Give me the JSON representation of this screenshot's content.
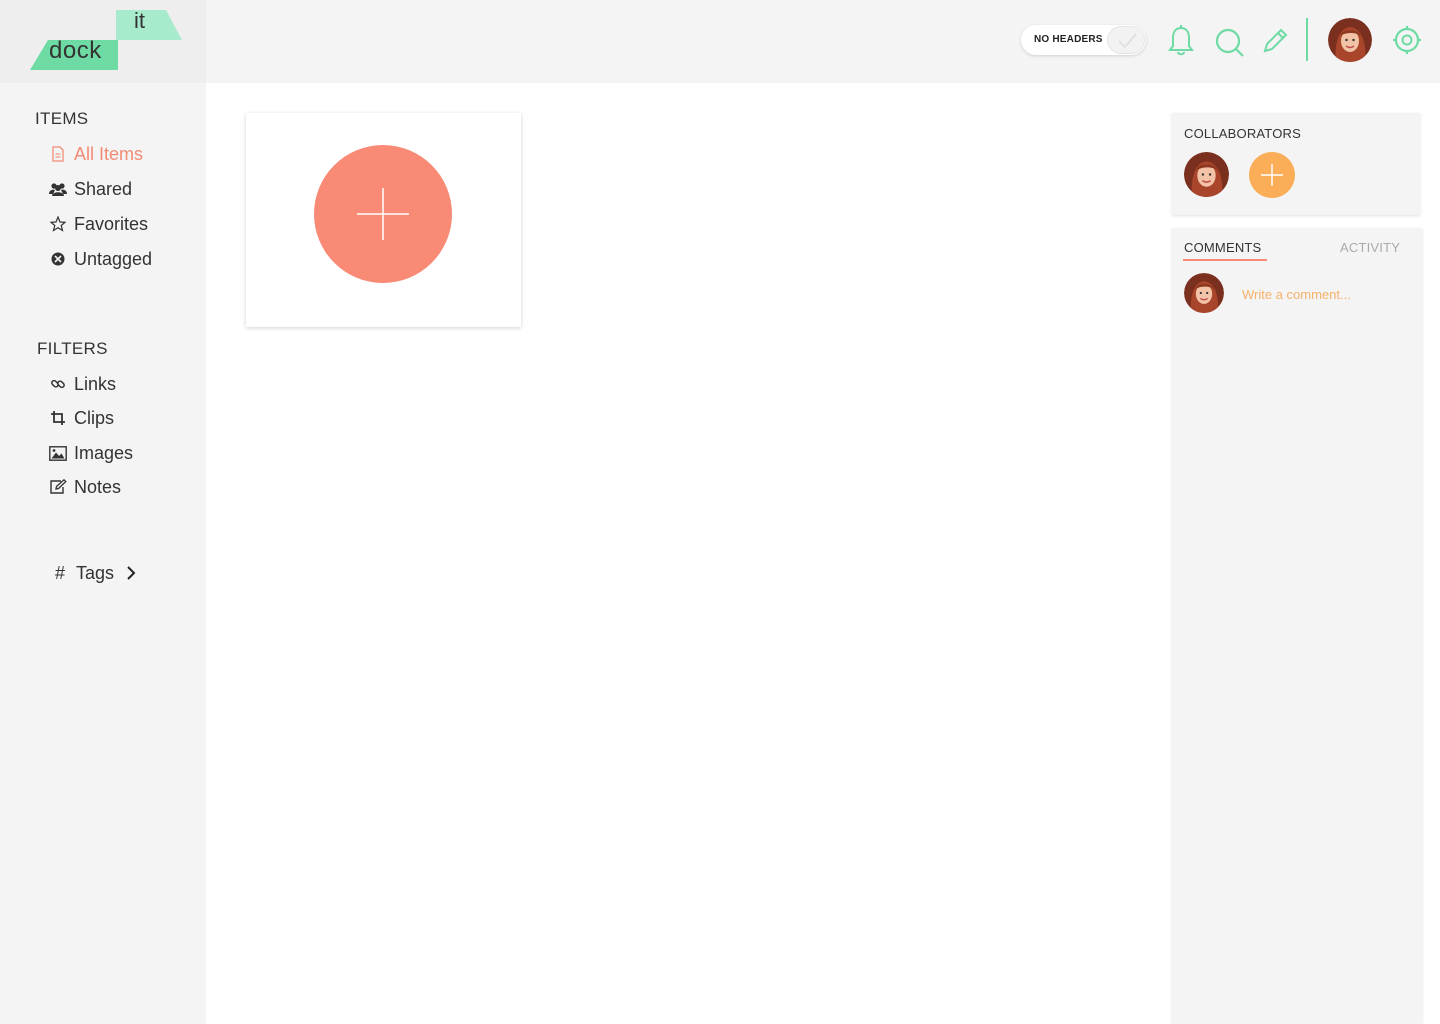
{
  "brand": {
    "logo_top": "it",
    "logo_bottom": "dock"
  },
  "header": {
    "toggle_label": "NO HEADERS",
    "accent_color": "#6ddba3",
    "icons": [
      "bell-icon",
      "search-icon",
      "pencil-icon",
      "gear-icon"
    ]
  },
  "sidebar": {
    "items_title": "ITEMS",
    "items": [
      {
        "label": "All Items",
        "icon": "document-icon",
        "active": true
      },
      {
        "label": "Shared",
        "icon": "users-icon"
      },
      {
        "label": "Favorites",
        "icon": "star-icon"
      },
      {
        "label": "Untagged",
        "icon": "untagged-icon"
      }
    ],
    "filters_title": "FILTERS",
    "filters": [
      {
        "label": "Links",
        "icon": "link-icon"
      },
      {
        "label": "Clips",
        "icon": "crop-icon"
      },
      {
        "label": "Images",
        "icon": "image-icon"
      },
      {
        "label": "Notes",
        "icon": "edit-icon"
      }
    ],
    "tags": {
      "symbol": "#",
      "label": "Tags"
    }
  },
  "right_panel": {
    "collaborators_title": "COLLABORATORS",
    "tabs": [
      {
        "label": "COMMENTS",
        "active": true
      },
      {
        "label": "ACTIVITY",
        "active": false
      }
    ],
    "comment_placeholder": "Write a comment..."
  },
  "colors": {
    "active_nav": "#f38b74",
    "add_button": "#f98a76",
    "add_collaborator": "#fbae57"
  }
}
